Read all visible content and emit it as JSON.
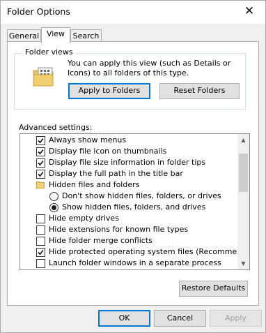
{
  "window": {
    "title": "Folder Options",
    "close_glyph": "✕"
  },
  "tabs": [
    {
      "label": "General",
      "active": false
    },
    {
      "label": "View",
      "active": true
    },
    {
      "label": "Search",
      "active": false
    }
  ],
  "folder_views": {
    "group_label": "Folder views",
    "description": "You can apply this view (such as Details or Icons) to all folders of this type.",
    "apply_button": "Apply to Folders",
    "reset_button": "Reset Folders",
    "icon": "folder-views-icon"
  },
  "advanced": {
    "label": "Advanced settings:",
    "items": [
      {
        "type": "checkbox",
        "label": "Always show menus",
        "checked": true,
        "indent": 0
      },
      {
        "type": "checkbox",
        "label": "Display file icon on thumbnails",
        "checked": true,
        "indent": 0
      },
      {
        "type": "checkbox",
        "label": "Display file size information in folder tips",
        "checked": true,
        "indent": 0
      },
      {
        "type": "checkbox",
        "label": "Display the full path in the title bar",
        "checked": true,
        "indent": 0
      },
      {
        "type": "folder",
        "label": "Hidden files and folders",
        "indent": 0
      },
      {
        "type": "radio",
        "label": "Don't show hidden files, folders, or drives",
        "checked": false,
        "indent": 1
      },
      {
        "type": "radio",
        "label": "Show hidden files, folders, and drives",
        "checked": true,
        "indent": 1
      },
      {
        "type": "checkbox",
        "label": "Hide empty drives",
        "checked": false,
        "indent": 0
      },
      {
        "type": "checkbox",
        "label": "Hide extensions for known file types",
        "checked": false,
        "indent": 0
      },
      {
        "type": "checkbox",
        "label": "Hide folder merge conflicts",
        "checked": false,
        "indent": 0
      },
      {
        "type": "checkbox",
        "label": "Hide protected operating system files (Recommended)",
        "checked": true,
        "indent": 0
      },
      {
        "type": "checkbox",
        "label": "Launch folder windows in a separate process",
        "checked": false,
        "indent": 0
      }
    ],
    "scroll_up_glyph": "▲",
    "scroll_down_glyph": "▼"
  },
  "restore_defaults_button": "Restore Defaults",
  "footer": {
    "ok": "OK",
    "cancel": "Cancel",
    "apply": "Apply"
  }
}
